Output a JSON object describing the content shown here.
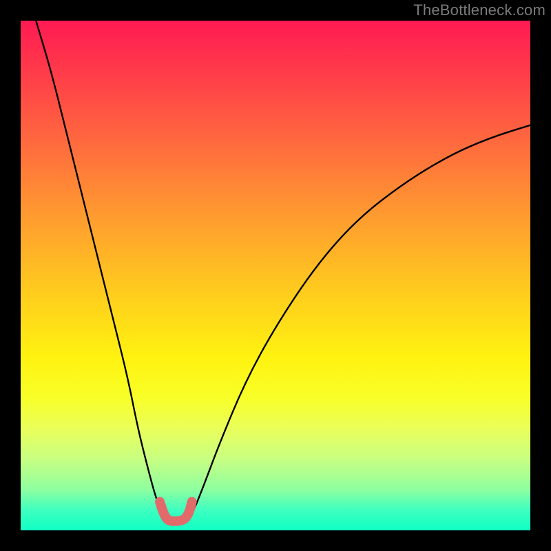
{
  "watermark": "TheBottleneck.com",
  "chart_data": {
    "type": "line",
    "title": "",
    "xlabel": "",
    "ylabel": "",
    "xlim": [
      0,
      100
    ],
    "ylim": [
      0,
      100
    ],
    "grid": false,
    "legend": false,
    "series": [
      {
        "name": "left-branch",
        "stroke": "#000000",
        "x": [
          3,
          6,
          9,
          12,
          15,
          18,
          21,
          23,
          25,
          26.5,
          27.5,
          28.5,
          29,
          29.5
        ],
        "y": [
          100,
          90,
          78,
          66,
          54,
          42,
          30,
          20,
          12,
          6.5,
          4,
          2.5,
          2,
          2
        ]
      },
      {
        "name": "right-branch",
        "stroke": "#000000",
        "x": [
          32.5,
          33,
          34,
          36,
          39,
          44,
          50,
          58,
          66,
          75,
          84,
          92,
          100
        ],
        "y": [
          2,
          2.3,
          4,
          9,
          17,
          29,
          40,
          52,
          61,
          68,
          73.5,
          77,
          79.5
        ]
      },
      {
        "name": "trough-highlight",
        "stroke": "#e26a6a",
        "x": [
          27.3,
          27.8,
          28.3,
          28.8,
          29.5,
          30.5,
          31.5,
          32.3,
          32.9,
          33.3,
          33.6
        ],
        "y": [
          5.6,
          4.0,
          2.8,
          2.1,
          1.8,
          1.8,
          1.9,
          2.3,
          3.2,
          4.3,
          5.6
        ]
      }
    ],
    "background_gradient": {
      "top": "#ff1a52",
      "bottom": "#10ffc4"
    }
  }
}
